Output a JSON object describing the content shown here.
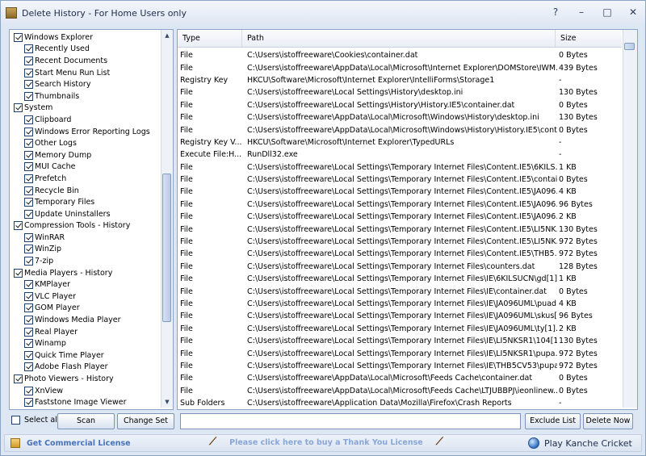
{
  "window": {
    "title": "Delete History - For Home Users only",
    "help": "?",
    "minimize": "–",
    "maximize": "□",
    "close": "✕"
  },
  "tree": {
    "items": [
      {
        "label": "Windows Explorer",
        "level": 0,
        "checked": true
      },
      {
        "label": "Recently Used",
        "level": 1,
        "checked": true
      },
      {
        "label": "Recent Documents",
        "level": 1,
        "checked": true
      },
      {
        "label": "Start Menu Run List",
        "level": 1,
        "checked": true
      },
      {
        "label": "Search History",
        "level": 1,
        "checked": true
      },
      {
        "label": "Thumbnails",
        "level": 1,
        "checked": true
      },
      {
        "label": "System",
        "level": 0,
        "checked": true
      },
      {
        "label": "Clipboard",
        "level": 1,
        "checked": true
      },
      {
        "label": "Windows Error Reporting Logs",
        "level": 1,
        "checked": true
      },
      {
        "label": "Other Logs",
        "level": 1,
        "checked": true
      },
      {
        "label": "Memory Dump",
        "level": 1,
        "checked": true
      },
      {
        "label": "MUI Cache",
        "level": 1,
        "checked": true
      },
      {
        "label": "Prefetch",
        "level": 1,
        "checked": true
      },
      {
        "label": "Recycle Bin",
        "level": 1,
        "checked": true
      },
      {
        "label": "Temporary Files",
        "level": 1,
        "checked": true
      },
      {
        "label": "Update Uninstallers",
        "level": 1,
        "checked": true
      },
      {
        "label": "Compression Tools - History",
        "level": 0,
        "checked": true
      },
      {
        "label": "WinRAR",
        "level": 1,
        "checked": true
      },
      {
        "label": "WinZip",
        "level": 1,
        "checked": true
      },
      {
        "label": "7-zip",
        "level": 1,
        "checked": true
      },
      {
        "label": "Media Players - History",
        "level": 0,
        "checked": true
      },
      {
        "label": "KMPlayer",
        "level": 1,
        "checked": true
      },
      {
        "label": "VLC Player",
        "level": 1,
        "checked": true
      },
      {
        "label": "GOM Player",
        "level": 1,
        "checked": true
      },
      {
        "label": "Windows Media Player",
        "level": 1,
        "checked": true
      },
      {
        "label": "Real Player",
        "level": 1,
        "checked": true
      },
      {
        "label": "Winamp",
        "level": 1,
        "checked": true
      },
      {
        "label": "Quick Time Player",
        "level": 1,
        "checked": true
      },
      {
        "label": "Adobe Flash Player",
        "level": 1,
        "checked": true
      },
      {
        "label": "Photo Viewers - History",
        "level": 0,
        "checked": true
      },
      {
        "label": "XnView",
        "level": 1,
        "checked": true
      },
      {
        "label": "Faststone Image Viewer",
        "level": 1,
        "checked": true
      }
    ]
  },
  "list": {
    "columns": [
      "Type",
      "Path",
      "Size"
    ],
    "rows": [
      [
        "File",
        "C:\\Users\\istoffreeware\\Cookies\\container.dat",
        "0 Bytes"
      ],
      [
        "File",
        "C:\\Users\\istoffreeware\\AppData\\Local\\Microsoft\\Internet Explorer\\DOMStore\\IWM...",
        "439 Bytes"
      ],
      [
        "Registry Key",
        "HKCU\\Software\\Microsoft\\Internet Explorer\\IntelliForms\\Storage1",
        "-"
      ],
      [
        "File",
        "C:\\Users\\istoffreeware\\Local Settings\\History\\desktop.ini",
        "130 Bytes"
      ],
      [
        "File",
        "C:\\Users\\istoffreeware\\Local Settings\\History\\History.IE5\\container.dat",
        "0 Bytes"
      ],
      [
        "File",
        "C:\\Users\\istoffreeware\\AppData\\Local\\Microsoft\\Windows\\History\\desktop.ini",
        "130 Bytes"
      ],
      [
        "File",
        "C:\\Users\\istoffreeware\\AppData\\Local\\Microsoft\\Windows\\History\\History.IE5\\cont...",
        "0 Bytes"
      ],
      [
        "Registry Key V...",
        "HKCU\\Software\\Microsoft\\Internet Explorer\\TypedURLs",
        "-"
      ],
      [
        "Execute File:H...",
        "RunDll32.exe",
        "-"
      ],
      [
        "File",
        "C:\\Users\\istoffreeware\\Local Settings\\Temporary Internet Files\\Content.IE5\\6KILS...",
        "1 KB"
      ],
      [
        "File",
        "C:\\Users\\istoffreeware\\Local Settings\\Temporary Internet Files\\Content.IE5\\contai...",
        "0 Bytes"
      ],
      [
        "File",
        "C:\\Users\\istoffreeware\\Local Settings\\Temporary Internet Files\\Content.IE5\\JA096...",
        "4 KB"
      ],
      [
        "File",
        "C:\\Users\\istoffreeware\\Local Settings\\Temporary Internet Files\\Content.IE5\\JA096...",
        "96 Bytes"
      ],
      [
        "File",
        "C:\\Users\\istoffreeware\\Local Settings\\Temporary Internet Files\\Content.IE5\\JA096...",
        "2 KB"
      ],
      [
        "File",
        "C:\\Users\\istoffreeware\\Local Settings\\Temporary Internet Files\\Content.IE5\\LI5NK...",
        "130 Bytes"
      ],
      [
        "File",
        "C:\\Users\\istoffreeware\\Local Settings\\Temporary Internet Files\\Content.IE5\\LI5NK...",
        "972 Bytes"
      ],
      [
        "File",
        "C:\\Users\\istoffreeware\\Local Settings\\Temporary Internet Files\\Content.IE5\\THB5...",
        "972 Bytes"
      ],
      [
        "File",
        "C:\\Users\\istoffreeware\\Local Settings\\Temporary Internet Files\\counters.dat",
        "128 Bytes"
      ],
      [
        "File",
        "C:\\Users\\istoffreeware\\Local Settings\\Temporary Internet Files\\IE\\6KILSUCN\\gd[1]...",
        "1 KB"
      ],
      [
        "File",
        "C:\\Users\\istoffreeware\\Local Settings\\Temporary Internet Files\\IE\\container.dat",
        "0 Bytes"
      ],
      [
        "File",
        "C:\\Users\\istoffreeware\\Local Settings\\Temporary Internet Files\\IE\\JA096UML\\puad...",
        "4 KB"
      ],
      [
        "File",
        "C:\\Users\\istoffreeware\\Local Settings\\Temporary Internet Files\\IE\\JA096UML\\skus[...",
        "96 Bytes"
      ],
      [
        "File",
        "C:\\Users\\istoffreeware\\Local Settings\\Temporary Internet Files\\IE\\JA096UML\\ty[1]...",
        "2 KB"
      ],
      [
        "File",
        "C:\\Users\\istoffreeware\\Local Settings\\Temporary Internet Files\\IE\\LI5NKSR1\\104[1]",
        "130 Bytes"
      ],
      [
        "File",
        "C:\\Users\\istoffreeware\\Local Settings\\Temporary Internet Files\\IE\\LI5NKSR1\\pupa...",
        "972 Bytes"
      ],
      [
        "File",
        "C:\\Users\\istoffreeware\\Local Settings\\Temporary Internet Files\\IE\\THB5CV53\\pupa...",
        "972 Bytes"
      ],
      [
        "File",
        "C:\\Users\\istoffreeware\\AppData\\Local\\Microsoft\\Feeds Cache\\container.dat",
        "0 Bytes"
      ],
      [
        "File",
        "C:\\Users\\istoffreeware\\AppData\\Local\\Microsoft\\Feeds Cache\\LTJUBBPJ\\ieonlinew...",
        "0 Bytes"
      ],
      [
        "Sub Folders",
        "C:\\Users\\istoffreeware\\Application Data\\Mozilla\\Firefox\\Crash Reports",
        "-"
      ]
    ]
  },
  "bottom": {
    "select_all": "Select all",
    "scan": "Scan",
    "change_set": "Change Set",
    "filter_value": "",
    "exclude_list": "Exclude List",
    "delete_now": "Delete Now"
  },
  "status": {
    "license": "Get Commercial License",
    "thanks": "Please click here to buy a Thank You License",
    "cricket": "Play Kanche Cricket"
  }
}
